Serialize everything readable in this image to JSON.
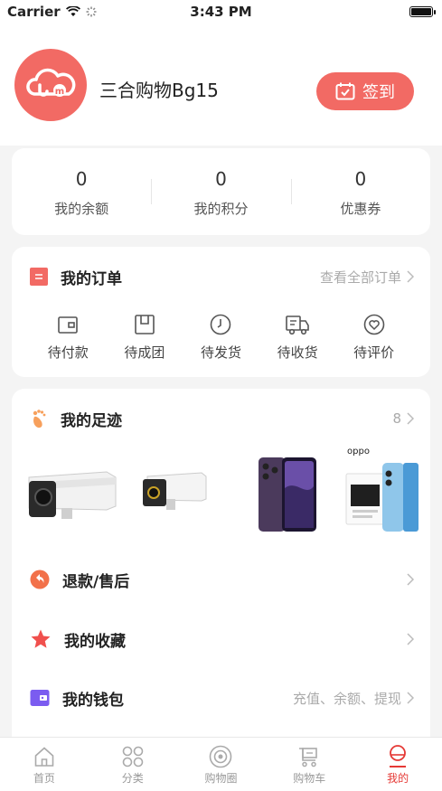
{
  "status_bar": {
    "carrier": "Carrier",
    "time": "3:43 PM"
  },
  "profile": {
    "username": "三合购物Bg15",
    "checkin_label": "签到"
  },
  "stats": [
    {
      "value": "0",
      "label": "我的余额"
    },
    {
      "value": "0",
      "label": "我的积分"
    },
    {
      "value": "0",
      "label": "优惠券"
    }
  ],
  "orders": {
    "title": "我的订单",
    "view_all": "查看全部订单",
    "items": [
      {
        "label": "待付款",
        "icon": "wallet-icon"
      },
      {
        "label": "待成团",
        "icon": "box-icon"
      },
      {
        "label": "待发货",
        "icon": "clock-icon"
      },
      {
        "label": "待收货",
        "icon": "truck-icon"
      },
      {
        "label": "待评价",
        "icon": "heart-icon"
      }
    ]
  },
  "footprints": {
    "title": "我的足迹",
    "count": "8",
    "brand_text": "oppo"
  },
  "menu": [
    {
      "title": "退款/售后",
      "extra": ""
    },
    {
      "title": "我的收藏",
      "extra": ""
    },
    {
      "title": "我的钱包",
      "extra": "充值、余额、提现"
    }
  ],
  "tabs": [
    {
      "label": "首页",
      "icon": "home-icon"
    },
    {
      "label": "分类",
      "icon": "grid-icon"
    },
    {
      "label": "购物圈",
      "icon": "circle-icon"
    },
    {
      "label": "购物车",
      "icon": "cart-icon"
    },
    {
      "label": "我的",
      "icon": "profile-icon"
    }
  ],
  "colors": {
    "accent": "#f26a64",
    "active_tab": "#e53935"
  }
}
